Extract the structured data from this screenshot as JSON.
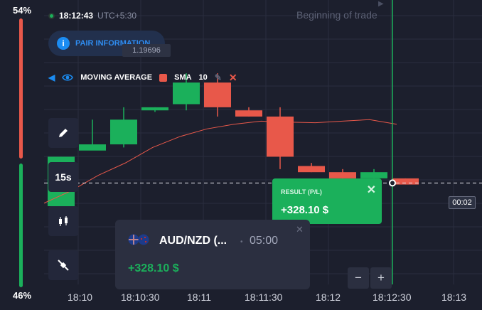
{
  "sentiment": {
    "top_pct": "54%",
    "bottom_pct": "46%"
  },
  "header": {
    "time": "18:12:43",
    "timezone": "UTC+5:30",
    "beginning_label": "Beginning of trade"
  },
  "pair_info": {
    "label": "PAIR INFORMATION",
    "price_tag": "1.19696"
  },
  "indicator": {
    "name": "MOVING AVERAGE",
    "type": "SMA",
    "period": "10"
  },
  "toolbar": {
    "timeframe": "15s"
  },
  "result": {
    "label": "RESULT (P/L)",
    "value": "+328.10 $"
  },
  "timer": {
    "value": "00:02"
  },
  "trade_card": {
    "pair": "AUD/NZD (...",
    "duration": "05:00",
    "profit": "+328.10 $"
  },
  "zoom": {
    "minus": "−",
    "plus": "+"
  },
  "x_ticks": [
    "18:10",
    "18:10:30",
    "18:11",
    "18:11:30",
    "18:12",
    "18:12:30",
    "18:13"
  ],
  "colors": {
    "up": "#1bb05b",
    "down": "#e8584a",
    "accent": "#1b8cf2",
    "bg": "#1c1f2d"
  },
  "chart_data": {
    "type": "candlestick",
    "candles": [
      {
        "dir": "up",
        "open": 1.194,
        "close": 1.1956,
        "high": 1.1956,
        "low": 1.194
      },
      {
        "dir": "up",
        "open": 1.1958,
        "close": 1.196,
        "high": 1.1968,
        "low": 1.1959
      },
      {
        "dir": "up",
        "open": 1.196,
        "close": 1.1968,
        "high": 1.1972,
        "low": 1.1959
      },
      {
        "dir": "up",
        "open": 1.1971,
        "close": 1.1972,
        "high": 1.1972,
        "low": 1.19705
      },
      {
        "dir": "up",
        "open": 1.1973,
        "close": 1.198,
        "high": 1.1983,
        "low": 1.1971
      },
      {
        "dir": "down",
        "open": 1.198,
        "close": 1.1972,
        "high": 1.1983,
        "low": 1.1969
      },
      {
        "dir": "down",
        "open": 1.1971,
        "close": 1.1969,
        "high": 1.1972,
        "low": 1.1969
      },
      {
        "dir": "down",
        "open": 1.1969,
        "close": 1.1956,
        "high": 1.1972,
        "low": 1.1952
      },
      {
        "dir": "down",
        "open": 1.1953,
        "close": 1.1951,
        "high": 1.1954,
        "low": 1.1951
      },
      {
        "dir": "down",
        "open": 1.1951,
        "close": 1.1949,
        "high": 1.1952,
        "low": 1.1949
      },
      {
        "dir": "up",
        "open": 1.1949,
        "close": 1.1951,
        "high": 1.1952,
        "low": 1.1949
      },
      {
        "dir": "down",
        "open": 1.1949,
        "close": 1.1947,
        "high": 1.1949,
        "low": 1.1947
      }
    ],
    "sma": [
      1.1941,
      1.1945,
      1.195,
      1.1954,
      1.1959,
      1.19625,
      1.1965,
      1.19665,
      1.19675,
      1.19672,
      1.1967,
      1.19675,
      1.1968,
      1.19665
    ],
    "ylim": [
      1.194,
      1.1986
    ],
    "current_price": 1.19475
  }
}
